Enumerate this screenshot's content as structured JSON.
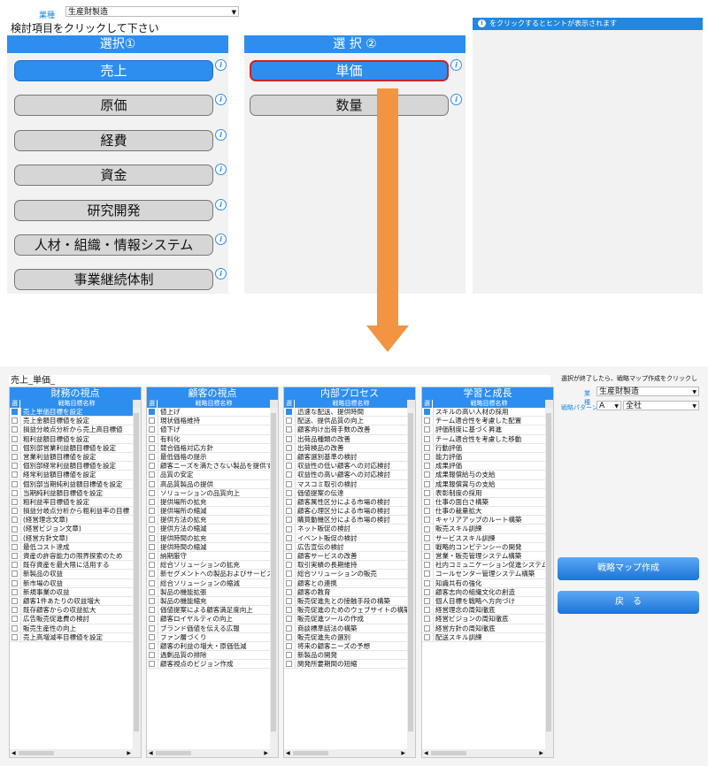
{
  "top": {
    "industry_label": "業種",
    "industry_value": "生産財製造",
    "instruction": "検討項目をクリックして下さい",
    "panel1_title": "選択①",
    "panel2_title": "選 択 ②",
    "hint_text": "をクリックするとヒントが表示されます",
    "panel1_items": [
      "売上",
      "原価",
      "経費",
      "資金",
      "研究開発",
      "人材・組織・情報システム",
      "事業継続体制"
    ],
    "panel2_items": [
      "単価",
      "数量"
    ]
  },
  "bottom": {
    "breadcrumb": "売上_単価_",
    "sel_header": "選",
    "name_header": "戦略目標名称",
    "note": "選択が終了したら、戦略マップ作成をクリックし",
    "industry_label": "業種",
    "industry_value": "生産財製造",
    "pattern_label": "戦略パターン",
    "pattern_value": "A",
    "scope_value": "全社",
    "create_button": "戦略マップ作成",
    "back_button": "戻　る",
    "columns": [
      {
        "title": "財務の視点",
        "items": [
          "売上単価目標を設定",
          "売上金額目標値を設定",
          "損益分岐点分析から売上高目標値",
          "粗利益額目標値を設定",
          "個別部営業利益額目標値を設定",
          "営業利益額目標値を設定",
          "個別部経常利益額目標値を設定",
          "経常利益額目標値を設定",
          "個別部当期純利益額目標値を設定",
          "当期純利益額目標値を設定",
          "粗利益率目標値を設定",
          "損益分岐点分析から粗利益率の目標",
          "(経営理念文章)",
          "(経営ビジョン文章)",
          "(経営方針文章)",
          "最低コスト達成",
          "資産の許容能力の限界探索のため",
          "既存資産を最大限に活用する",
          "新製品の収益",
          "新市場の収益",
          "新規事業の収益",
          "顧客1件あたりの収益増大",
          "既存顧客からの収益拡大",
          "広告販売促進費の検討",
          "販売生産性の向上",
          "売上高増減率目標値を設定"
        ]
      },
      {
        "title": "顧客の視点",
        "items": [
          "値上げ",
          "現状価格維持",
          "値下げ",
          "有料化",
          "競合価格対応方針",
          "最低価格の提示",
          "顧客ニーズを満たさない製品を提供する",
          "品質の安定",
          "高品質製品の提供",
          "ソリューションの品質向上",
          "提供場所の拡充",
          "提供場所の縮減",
          "提供方法の拡充",
          "提供方法の縮減",
          "提供時間の拡充",
          "提供時間の縮減",
          "納期厳守",
          "総合ソリューションの拡充",
          "新セグメントへの製品およびサービス",
          "総合ソリューションの縮減",
          "製品の機能拡張",
          "製品の機能縮充",
          "価値提案による顧客満足度向上",
          "顧客ロイヤルティの向上",
          "ブランド価値を伝える広報",
          "ファン層づくり",
          "顧客の利益の増大・原価低減",
          "過剰品質の排除",
          "顧客視点のビジョン作成"
        ]
      },
      {
        "title": "内部プロセス",
        "items": [
          "迅速な配送、提供時間",
          "配送、提供品質の向上",
          "顧客向け出荷手数の改善",
          "出荷品種類の改善",
          "出荷検品の改善",
          "顧客選別基準の検討",
          "収益性の低い顧客への対応検討",
          "収益性の高い顧客への対応検討",
          "マスコミ取引の検討",
          "価値提案の伝達",
          "顧客属性区分による市場の検討",
          "顧客心理区分による市場の検討",
          "購買動機区分による市場の検討",
          "ネット販促の検討",
          "イベント販促の検討",
          "広告宣伝の検討",
          "顧客サービスの改善",
          "取引実績の長期維持",
          "総合ソリューションの販売",
          "顧客との連携",
          "顧客の教育",
          "販売促進先との接触手段の構築",
          "販売促進のためのウェブサイトの構築",
          "販売促進ツールの作成",
          "商談標準話法の構築",
          "販売促進先の選別",
          "将来の顧客ニーズの予想",
          "新製品の開発",
          "関発所要期間の短縮"
        ]
      },
      {
        "title": "学習と成長",
        "items": [
          "スキルの高い人材の採用",
          "チーム適合性を考慮した配置",
          "評価制度に基づく昇進",
          "チーム適合性を考慮した移動",
          "行動評価",
          "能力評価",
          "成果評価",
          "成果報償給与の支給",
          "成果報償賞与の支給",
          "表彰制度の採用",
          "仕事の面白さ構築",
          "仕事の裁量拡大",
          "キャリアアップのルート構築",
          "販売スキル訓練",
          "サービススキル訓練",
          "戦略的コンピテンシーの開発",
          "営業・販売管理システム構築",
          "社内コミュニケーション促進システム構",
          "コールセンター管理システム構築",
          "知識共有の強化",
          "顧客志向の組織文化の創造",
          "個人目標を戦略へ方向づけ",
          "経営理念の周知徹底",
          "経営ビジョンの周知徹底",
          "経営方針の周知徹底",
          "配送スキル訓練"
        ]
      }
    ]
  },
  "colors": {
    "accent": "#2d8ef0",
    "arrow": "#f29442",
    "highlight_border": "#d32020"
  },
  "icons": {
    "info": "info-icon",
    "arrow": "down-arrow-icon"
  }
}
